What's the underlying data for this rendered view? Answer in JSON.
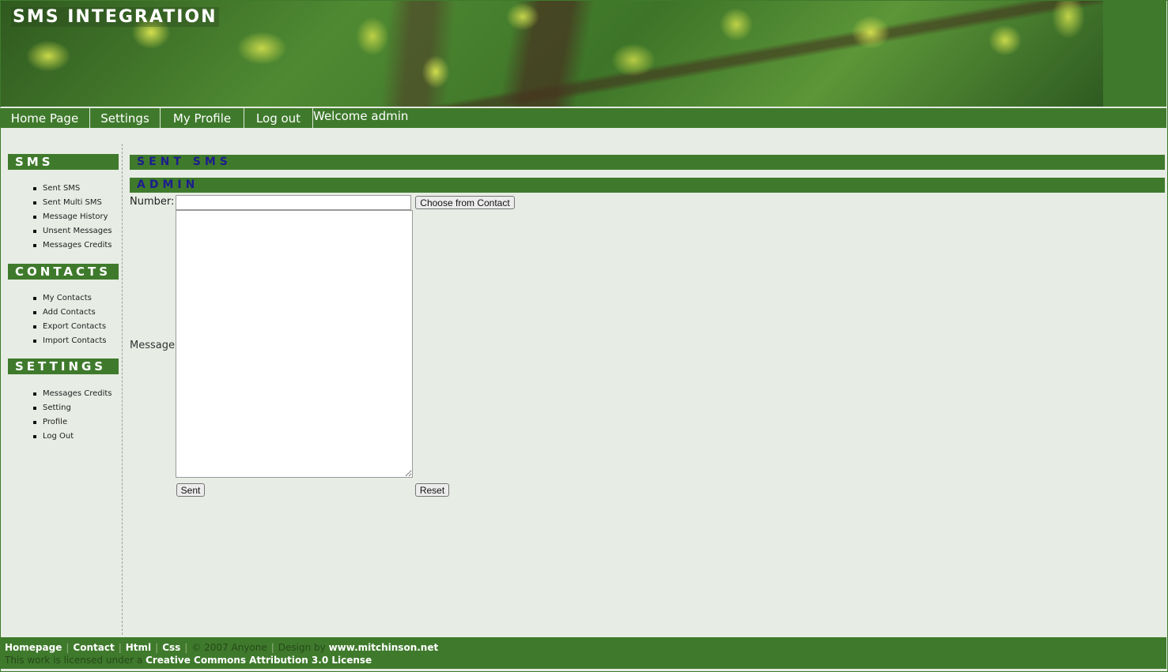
{
  "header": {
    "title": "SMS INTEGRATION"
  },
  "nav": {
    "items": [
      {
        "label": "Home Page"
      },
      {
        "label": "Settings"
      },
      {
        "label": "My Profile"
      },
      {
        "label": "Log out"
      }
    ],
    "welcome": "Welcome admin"
  },
  "sidebar": {
    "sections": [
      {
        "title": "SMS",
        "items": [
          "Sent SMS",
          "Sent Multi SMS",
          "Message History",
          "Unsent Messages",
          "Messages Credits"
        ]
      },
      {
        "title": "CONTACTS",
        "items": [
          "My Contacts",
          "Add Contacts",
          "Export Contacts",
          "Import Contacts"
        ]
      },
      {
        "title": "SETTINGS",
        "items": [
          "Messages Credits",
          "Setting",
          "Profile",
          "Log Out"
        ]
      }
    ]
  },
  "main": {
    "page_title": "SENT SMS",
    "user_heading": "ADMIN",
    "form": {
      "number_label": "Number:",
      "number_value": "",
      "choose_contact_label": "Choose from Contact",
      "message_label": "Message",
      "message_value": "",
      "send_label": "Sent",
      "reset_label": "Reset"
    }
  },
  "footer": {
    "links": [
      "Homepage",
      "Contact",
      "Html",
      "Css"
    ],
    "copyright": "© 2007 Anyone",
    "design_prefix": "Design by",
    "design_link": "www.mitchinson.net",
    "license_prefix": "This work is licensed under a",
    "license_link": "Creative Commons Attribution 3.0 License"
  },
  "colors": {
    "brand_green": "#3f7a2c",
    "page_background": "#e7ece4",
    "heading_text_blue": "#1d1d8c"
  }
}
